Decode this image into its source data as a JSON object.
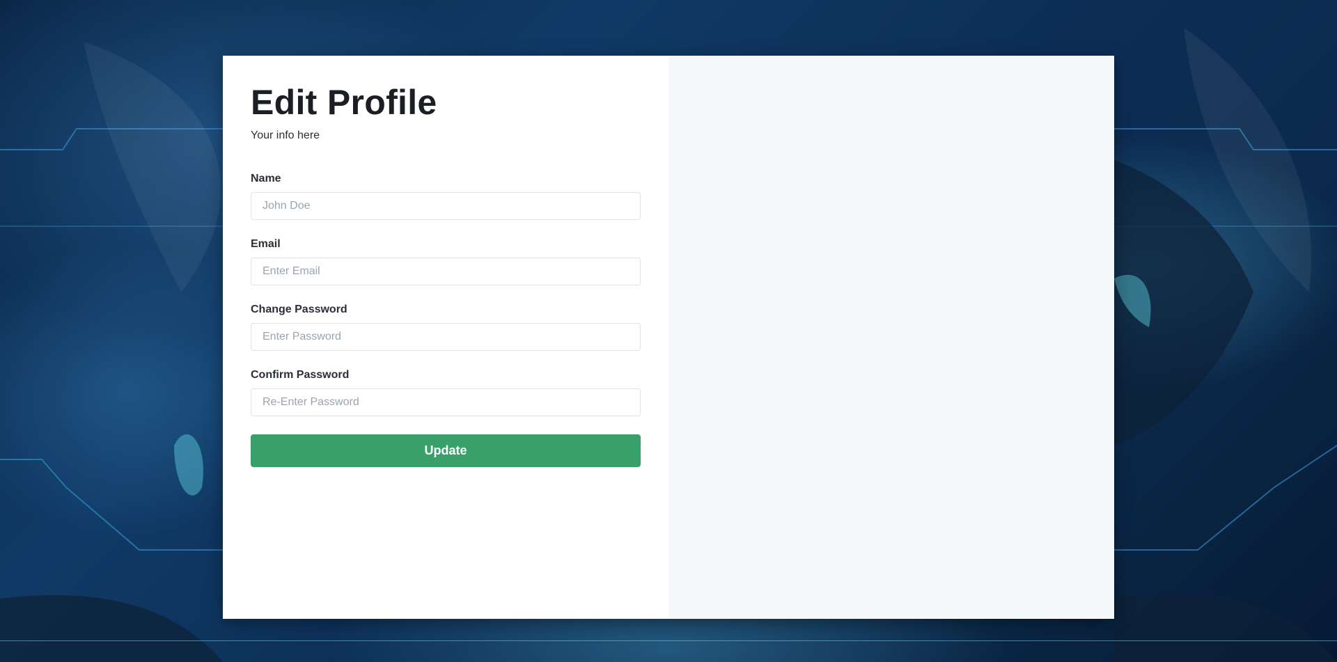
{
  "profile_form": {
    "title": "Edit Profile",
    "subtitle": "Your info here",
    "fields": [
      {
        "label": "Name",
        "placeholder": "John Doe",
        "value": ""
      },
      {
        "label": "Email",
        "placeholder": "Enter Email",
        "value": ""
      },
      {
        "label": "Change Password",
        "placeholder": "Enter Password",
        "value": ""
      },
      {
        "label": "Confirm Password",
        "placeholder": "Re-Enter Password",
        "value": ""
      }
    ],
    "submit_label": "Update"
  },
  "colors": {
    "button": "#38a169",
    "side_panel": "#f5f8fa",
    "background": "#0c2e55"
  }
}
